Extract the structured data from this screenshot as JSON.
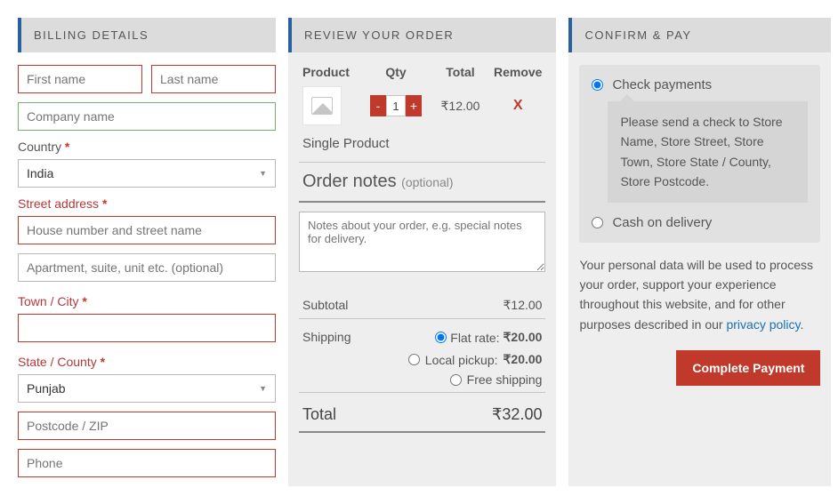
{
  "billing": {
    "header": "BILLING DETAILS",
    "first_name_ph": "First name",
    "last_name_ph": "Last name",
    "company_ph": "Company name",
    "country_label": "Country",
    "country_value": "India",
    "street_label": "Street address",
    "street1_ph": "House number and street name",
    "street2_ph": "Apartment, suite, unit etc. (optional)",
    "town_label": "Town / City",
    "state_label": "State / County",
    "state_value": "Punjab",
    "postcode_ph": "Postcode / ZIP",
    "phone_ph": "Phone",
    "asterisk": "*"
  },
  "review": {
    "header": "REVIEW YOUR ORDER",
    "cols": {
      "product": "Product",
      "qty": "Qty",
      "total": "Total",
      "remove": "Remove"
    },
    "item": {
      "qty": "1",
      "total": "₹12.00",
      "remove": "X",
      "name": "Single Product"
    },
    "order_notes_label": "Order notes",
    "order_notes_optional": "(optional)",
    "order_notes_ph": "Notes about your order, e.g. special notes for delivery.",
    "subtotal_label": "Subtotal",
    "subtotal_value": "₹12.00",
    "shipping_label": "Shipping",
    "shipping_options": [
      {
        "label": "Flat rate:",
        "price": "₹20.00",
        "checked": true
      },
      {
        "label": "Local pickup:",
        "price": "₹20.00",
        "checked": false
      },
      {
        "label": "Free shipping",
        "price": "",
        "checked": false
      }
    ],
    "total_label": "Total",
    "total_value": "₹32.00"
  },
  "confirm": {
    "header": "CONFIRM & PAY",
    "options": [
      {
        "label": "Check payments",
        "checked": true,
        "desc": "Please send a check to Store Name, Store Street, Store Town, Store State / County, Store Postcode."
      },
      {
        "label": "Cash on delivery",
        "checked": false
      }
    ],
    "privacy_text_1": "Your personal data will be used to process your order, support your experience throughout this website, and for other purposes described in our ",
    "privacy_link": "privacy policy",
    "privacy_text_2": ".",
    "complete_btn": "Complete Payment"
  }
}
